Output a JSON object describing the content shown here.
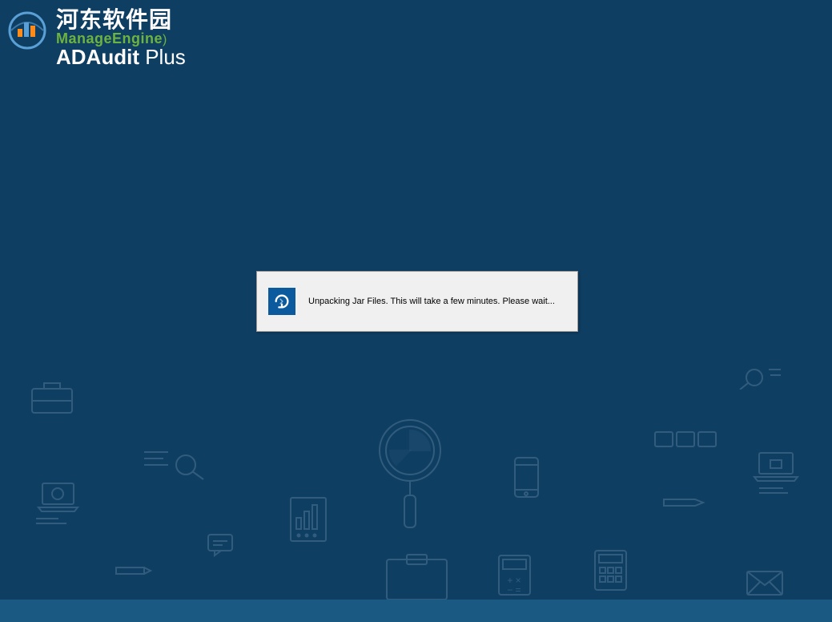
{
  "header": {
    "site_name": "河东软件园",
    "company": "ManageEngine",
    "company_suffix": ")",
    "product_bold": "ADAudit",
    "product_light": " Plus"
  },
  "dialog": {
    "icon": "refresh-icon",
    "message": "Unpacking Jar Files. This will take a few minutes. Please wait..."
  }
}
